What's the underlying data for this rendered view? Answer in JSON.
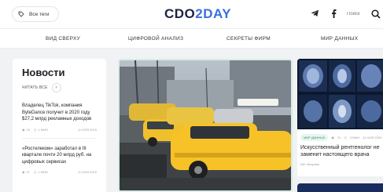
{
  "header": {
    "tags_label": "Все теги",
    "logo_main": "CDO",
    "logo_accent": "2DAY",
    "search_placeholder": "Поиск"
  },
  "nav": {
    "items": [
      "ВИД СВЕРХУ",
      "ЦИФРОВОЙ АНАЛИЗ",
      "СЕКРЕТЫ ФИРМ",
      "МИР ДАННЫХ"
    ]
  },
  "news": {
    "title": "Новости",
    "read_all": "ЧИТАТЬ ВСЕ",
    "items": [
      {
        "text": "Владелец TikTok, компания ByteDance получит в 2020 году $27,2 млрд рекламных доходов",
        "views": "15",
        "time": "1 МИН",
        "date": "11 НОЯ 2020"
      },
      {
        "text": "«Ростелеком» заработал в III квартале почти 20 млрд руб. на цифровых сервисах",
        "views": "37",
        "time": "1 МИН",
        "date": "11 НОЯ 2020"
      }
    ]
  },
  "feature": {
    "tag": "МИР ДАННЫХ",
    "views": "21",
    "time": "3 МИН",
    "date": "11 НОЯ 2020",
    "title": "Искусственный рентгенолог не заменит настоящего врача",
    "author": "ИИ: Infopoisk"
  },
  "colors": {
    "brand_dark": "#1b2340",
    "brand_accent": "#3a6fe0",
    "tag_bg": "#e6f6ef",
    "tag_fg": "#3a8a6a"
  }
}
